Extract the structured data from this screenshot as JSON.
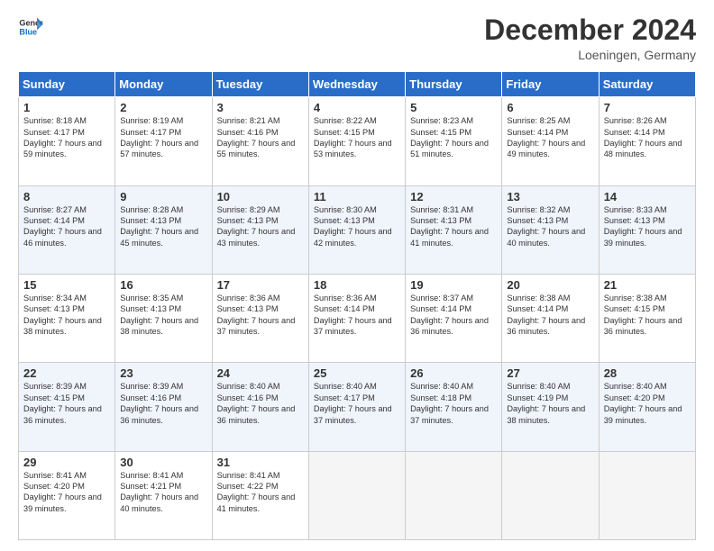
{
  "header": {
    "logo_general": "General",
    "logo_blue": "Blue",
    "month_title": "December 2024",
    "location": "Loeningen, Germany"
  },
  "days_of_week": [
    "Sunday",
    "Monday",
    "Tuesday",
    "Wednesday",
    "Thursday",
    "Friday",
    "Saturday"
  ],
  "weeks": [
    [
      {
        "day": 1,
        "sunrise": "8:18 AM",
        "sunset": "4:17 PM",
        "daylight": "7 hours and 59 minutes."
      },
      {
        "day": 2,
        "sunrise": "8:19 AM",
        "sunset": "4:17 PM",
        "daylight": "7 hours and 57 minutes."
      },
      {
        "day": 3,
        "sunrise": "8:21 AM",
        "sunset": "4:16 PM",
        "daylight": "7 hours and 55 minutes."
      },
      {
        "day": 4,
        "sunrise": "8:22 AM",
        "sunset": "4:15 PM",
        "daylight": "7 hours and 53 minutes."
      },
      {
        "day": 5,
        "sunrise": "8:23 AM",
        "sunset": "4:15 PM",
        "daylight": "7 hours and 51 minutes."
      },
      {
        "day": 6,
        "sunrise": "8:25 AM",
        "sunset": "4:14 PM",
        "daylight": "7 hours and 49 minutes."
      },
      {
        "day": 7,
        "sunrise": "8:26 AM",
        "sunset": "4:14 PM",
        "daylight": "7 hours and 48 minutes."
      }
    ],
    [
      {
        "day": 8,
        "sunrise": "8:27 AM",
        "sunset": "4:14 PM",
        "daylight": "7 hours and 46 minutes."
      },
      {
        "day": 9,
        "sunrise": "8:28 AM",
        "sunset": "4:13 PM",
        "daylight": "7 hours and 45 minutes."
      },
      {
        "day": 10,
        "sunrise": "8:29 AM",
        "sunset": "4:13 PM",
        "daylight": "7 hours and 43 minutes."
      },
      {
        "day": 11,
        "sunrise": "8:30 AM",
        "sunset": "4:13 PM",
        "daylight": "7 hours and 42 minutes."
      },
      {
        "day": 12,
        "sunrise": "8:31 AM",
        "sunset": "4:13 PM",
        "daylight": "7 hours and 41 minutes."
      },
      {
        "day": 13,
        "sunrise": "8:32 AM",
        "sunset": "4:13 PM",
        "daylight": "7 hours and 40 minutes."
      },
      {
        "day": 14,
        "sunrise": "8:33 AM",
        "sunset": "4:13 PM",
        "daylight": "7 hours and 39 minutes."
      }
    ],
    [
      {
        "day": 15,
        "sunrise": "8:34 AM",
        "sunset": "4:13 PM",
        "daylight": "7 hours and 38 minutes."
      },
      {
        "day": 16,
        "sunrise": "8:35 AM",
        "sunset": "4:13 PM",
        "daylight": "7 hours and 38 minutes."
      },
      {
        "day": 17,
        "sunrise": "8:36 AM",
        "sunset": "4:13 PM",
        "daylight": "7 hours and 37 minutes."
      },
      {
        "day": 18,
        "sunrise": "8:36 AM",
        "sunset": "4:14 PM",
        "daylight": "7 hours and 37 minutes."
      },
      {
        "day": 19,
        "sunrise": "8:37 AM",
        "sunset": "4:14 PM",
        "daylight": "7 hours and 36 minutes."
      },
      {
        "day": 20,
        "sunrise": "8:38 AM",
        "sunset": "4:14 PM",
        "daylight": "7 hours and 36 minutes."
      },
      {
        "day": 21,
        "sunrise": "8:38 AM",
        "sunset": "4:15 PM",
        "daylight": "7 hours and 36 minutes."
      }
    ],
    [
      {
        "day": 22,
        "sunrise": "8:39 AM",
        "sunset": "4:15 PM",
        "daylight": "7 hours and 36 minutes."
      },
      {
        "day": 23,
        "sunrise": "8:39 AM",
        "sunset": "4:16 PM",
        "daylight": "7 hours and 36 minutes."
      },
      {
        "day": 24,
        "sunrise": "8:40 AM",
        "sunset": "4:16 PM",
        "daylight": "7 hours and 36 minutes."
      },
      {
        "day": 25,
        "sunrise": "8:40 AM",
        "sunset": "4:17 PM",
        "daylight": "7 hours and 37 minutes."
      },
      {
        "day": 26,
        "sunrise": "8:40 AM",
        "sunset": "4:18 PM",
        "daylight": "7 hours and 37 minutes."
      },
      {
        "day": 27,
        "sunrise": "8:40 AM",
        "sunset": "4:19 PM",
        "daylight": "7 hours and 38 minutes."
      },
      {
        "day": 28,
        "sunrise": "8:40 AM",
        "sunset": "4:20 PM",
        "daylight": "7 hours and 39 minutes."
      }
    ],
    [
      {
        "day": 29,
        "sunrise": "8:41 AM",
        "sunset": "4:20 PM",
        "daylight": "7 hours and 39 minutes."
      },
      {
        "day": 30,
        "sunrise": "8:41 AM",
        "sunset": "4:21 PM",
        "daylight": "7 hours and 40 minutes."
      },
      {
        "day": 31,
        "sunrise": "8:41 AM",
        "sunset": "4:22 PM",
        "daylight": "7 hours and 41 minutes."
      },
      null,
      null,
      null,
      null
    ]
  ],
  "labels": {
    "sunrise": "Sunrise:",
    "sunset": "Sunset:",
    "daylight": "Daylight:"
  }
}
